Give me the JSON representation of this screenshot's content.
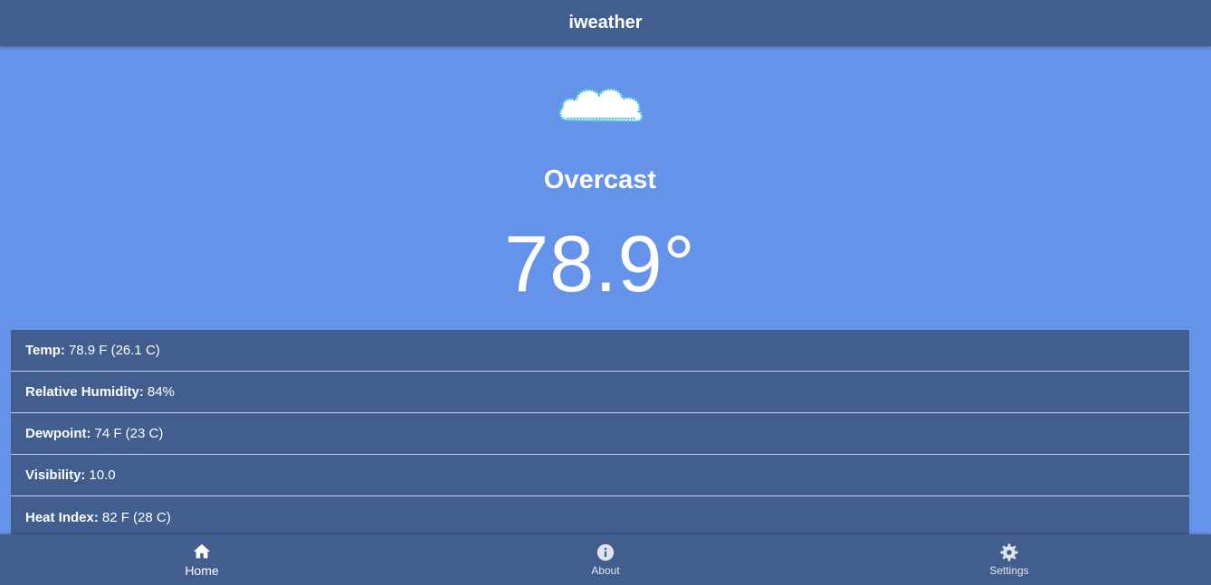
{
  "header": {
    "title": "iweather"
  },
  "current": {
    "icon": "cloud-icon",
    "condition": "Overcast",
    "temperature": "78.9°"
  },
  "details": [
    {
      "label": "Temp:",
      "value": "78.9 F (26.1 C)"
    },
    {
      "label": "Relative Humidity:",
      "value": "84%"
    },
    {
      "label": "Dewpoint:",
      "value": "74 F (23 C)"
    },
    {
      "label": "Visibility:",
      "value": "10.0"
    },
    {
      "label": "Heat Index:",
      "value": "82 F (28 C)"
    }
  ],
  "nav": {
    "items": [
      {
        "label": "Home",
        "icon": "home-icon",
        "active": true
      },
      {
        "label": "About",
        "icon": "info-icon",
        "active": false
      },
      {
        "label": "Settings",
        "icon": "gear-icon",
        "active": false
      }
    ]
  },
  "colors": {
    "background": "#6693ea",
    "bar": "#425e8e",
    "text": "#ffffff"
  }
}
